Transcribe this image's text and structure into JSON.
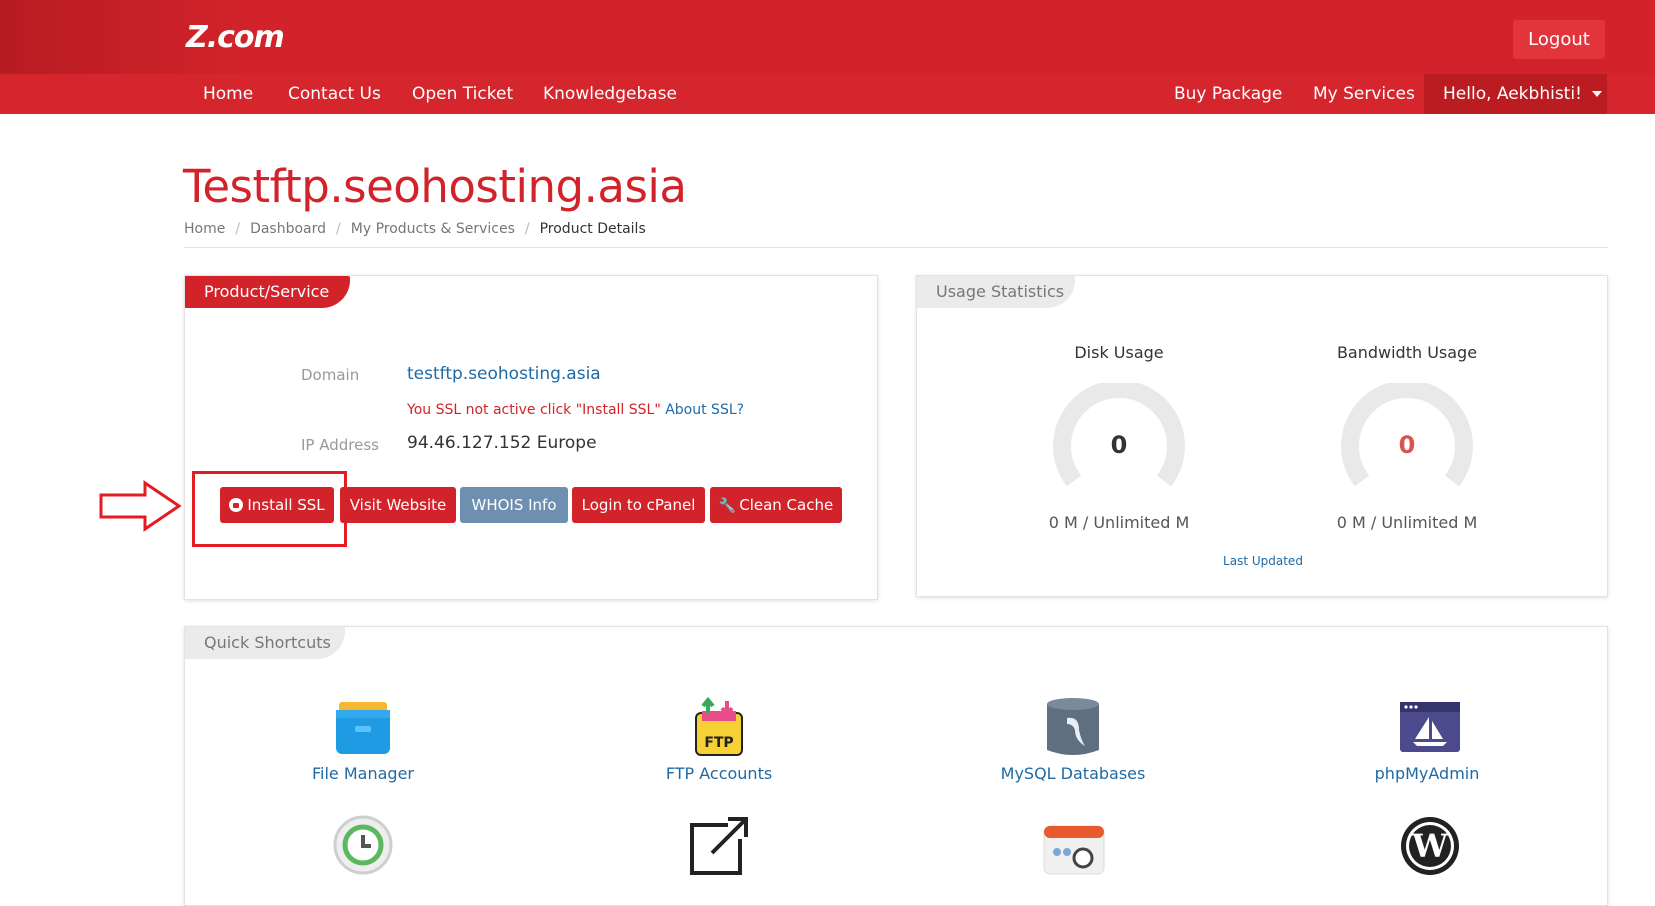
{
  "header": {
    "logo": "Z.com",
    "logout": "Logout"
  },
  "nav": {
    "left": [
      "Home",
      "Contact Us",
      "Open Ticket",
      "Knowledgebase"
    ],
    "right": [
      "Buy Package",
      "My Services"
    ],
    "user": "Hello, Aekbhisti!"
  },
  "page": {
    "title": "Testftp.seohosting.asia",
    "breadcrumb": [
      "Home",
      "Dashboard",
      "My Products & Services",
      "Product Details"
    ]
  },
  "product_panel": {
    "tab": "Product/Service",
    "domain_label": "Domain",
    "domain_value": "testftp.seohosting.asia",
    "ssl_msg": "You SSL not active click \"Install SSL\"",
    "about_ssl": "About SSL?",
    "ip_label": "IP Address",
    "ip_value": "94.46.127.152 Europe",
    "buttons": {
      "install_ssl": "Install SSL",
      "visit_website": "Visit Website",
      "whois": "WHOIS Info",
      "cpanel": "Login to cPanel",
      "clean_cache": "Clean Cache"
    }
  },
  "usage_panel": {
    "tab": "Usage Statistics",
    "disk": {
      "title": "Disk Usage",
      "value": "0",
      "sub": "0 M / Unlimited M"
    },
    "bandwidth": {
      "title": "Bandwidth Usage",
      "value": "0",
      "sub": "0 M / Unlimited M"
    },
    "last_updated": "Last Updated"
  },
  "shortcuts_panel": {
    "tab": "Quick Shortcuts",
    "items": [
      "File Manager",
      "FTP Accounts",
      "MySQL Databases",
      "phpMyAdmin"
    ]
  },
  "colors": {
    "brand_red": "#d2232a",
    "link_blue": "#1f6aa5",
    "whois_blue": "#6e8fb0"
  }
}
